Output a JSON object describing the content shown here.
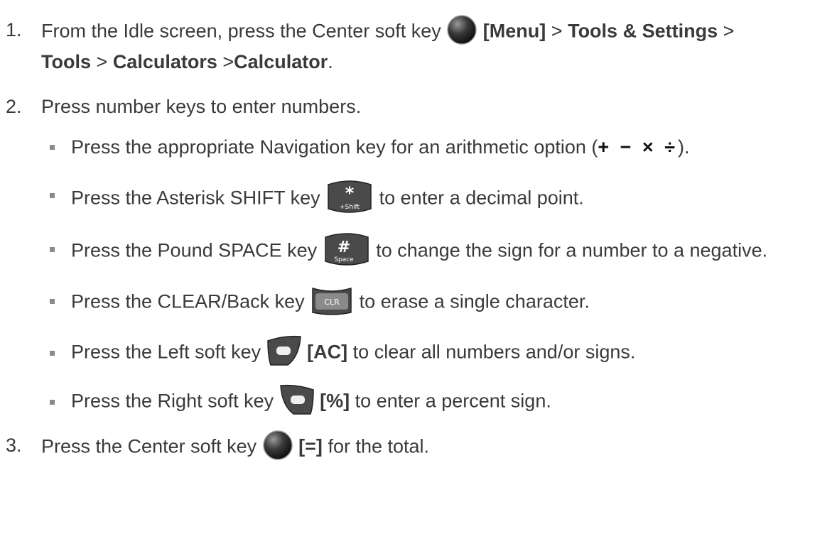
{
  "steps": [
    {
      "number": "1.",
      "text_before": "From the Idle screen, press the Center soft key",
      "menu": "[Menu]",
      "sep1": ">",
      "tools_settings": "Tools & Settings",
      "sep2": ">",
      "tools": "Tools",
      "sep3": ">",
      "calculators": "Calculators",
      "sep4": ">",
      "calculator": "Calculator",
      "end": "."
    },
    {
      "number": "2.",
      "text": "Press number keys to enter numbers."
    },
    {
      "number": "3.",
      "text_before": "Press the Center soft key",
      "key_label": "[=]",
      "text_after": "for the total."
    }
  ],
  "sub_items": [
    {
      "before": "Press the appropriate Navigation key for an arithmetic option (",
      "ops": "+ − × ÷",
      "after": ")."
    },
    {
      "before": "Press the Asterisk SHIFT key",
      "key_text": "*",
      "key_sub": "+Shift",
      "after": "to enter a decimal point."
    },
    {
      "before": "Press the Pound SPACE key",
      "key_text": "#",
      "key_sub": "Space",
      "after": "to change the sign for a number to a negative."
    },
    {
      "before": "Press the CLEAR/Back key",
      "key_text": "CLR",
      "after": "to erase a single character."
    },
    {
      "before": "Press the Left soft key",
      "bold": "[AC]",
      "after": "to clear all numbers and/or signs."
    },
    {
      "before": "Press the Right soft key",
      "bold": "[%]",
      "after": "to enter a percent sign."
    }
  ]
}
